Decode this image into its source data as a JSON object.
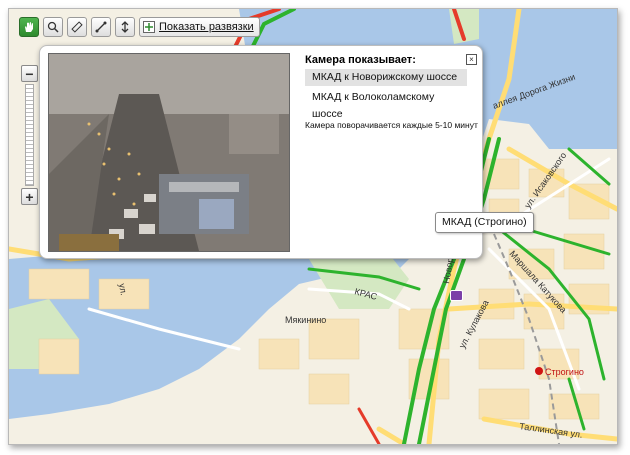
{
  "toolbar": {
    "show_junctions_label": "Показать развязки"
  },
  "popup": {
    "title": "Камера показывает:",
    "directions": [
      "МКАД к Новорижскому шоссе",
      "МКАД к Волоколамскому шоссе"
    ],
    "note": "Камера поворачивается каждые 5-10 минут",
    "close_glyph": "×"
  },
  "camera_tooltip": "МКАД (Строгино)",
  "zoom": {
    "plus": "+",
    "minus": "−"
  },
  "map_labels": {
    "myakinino": "Мякинино",
    "strogino_station": "Строгино",
    "isakovskogo": "ул. Исаковского",
    "katukova": "Маршала Катукова",
    "kulakova": "ул. Кулакова",
    "tallinskaya": "Таллинская ул.",
    "doroga_zhizni": "аллея Дорога Жизни",
    "krasnogorsk": "Новорижское",
    "ul_left": "ул.",
    "kras": "КРАС"
  },
  "colors": {
    "water": "#a9c7e8",
    "road": "#ffdd75",
    "traffic_green": "#2db32d",
    "traffic_red": "#e53b2a",
    "metro": "#d01414"
  }
}
